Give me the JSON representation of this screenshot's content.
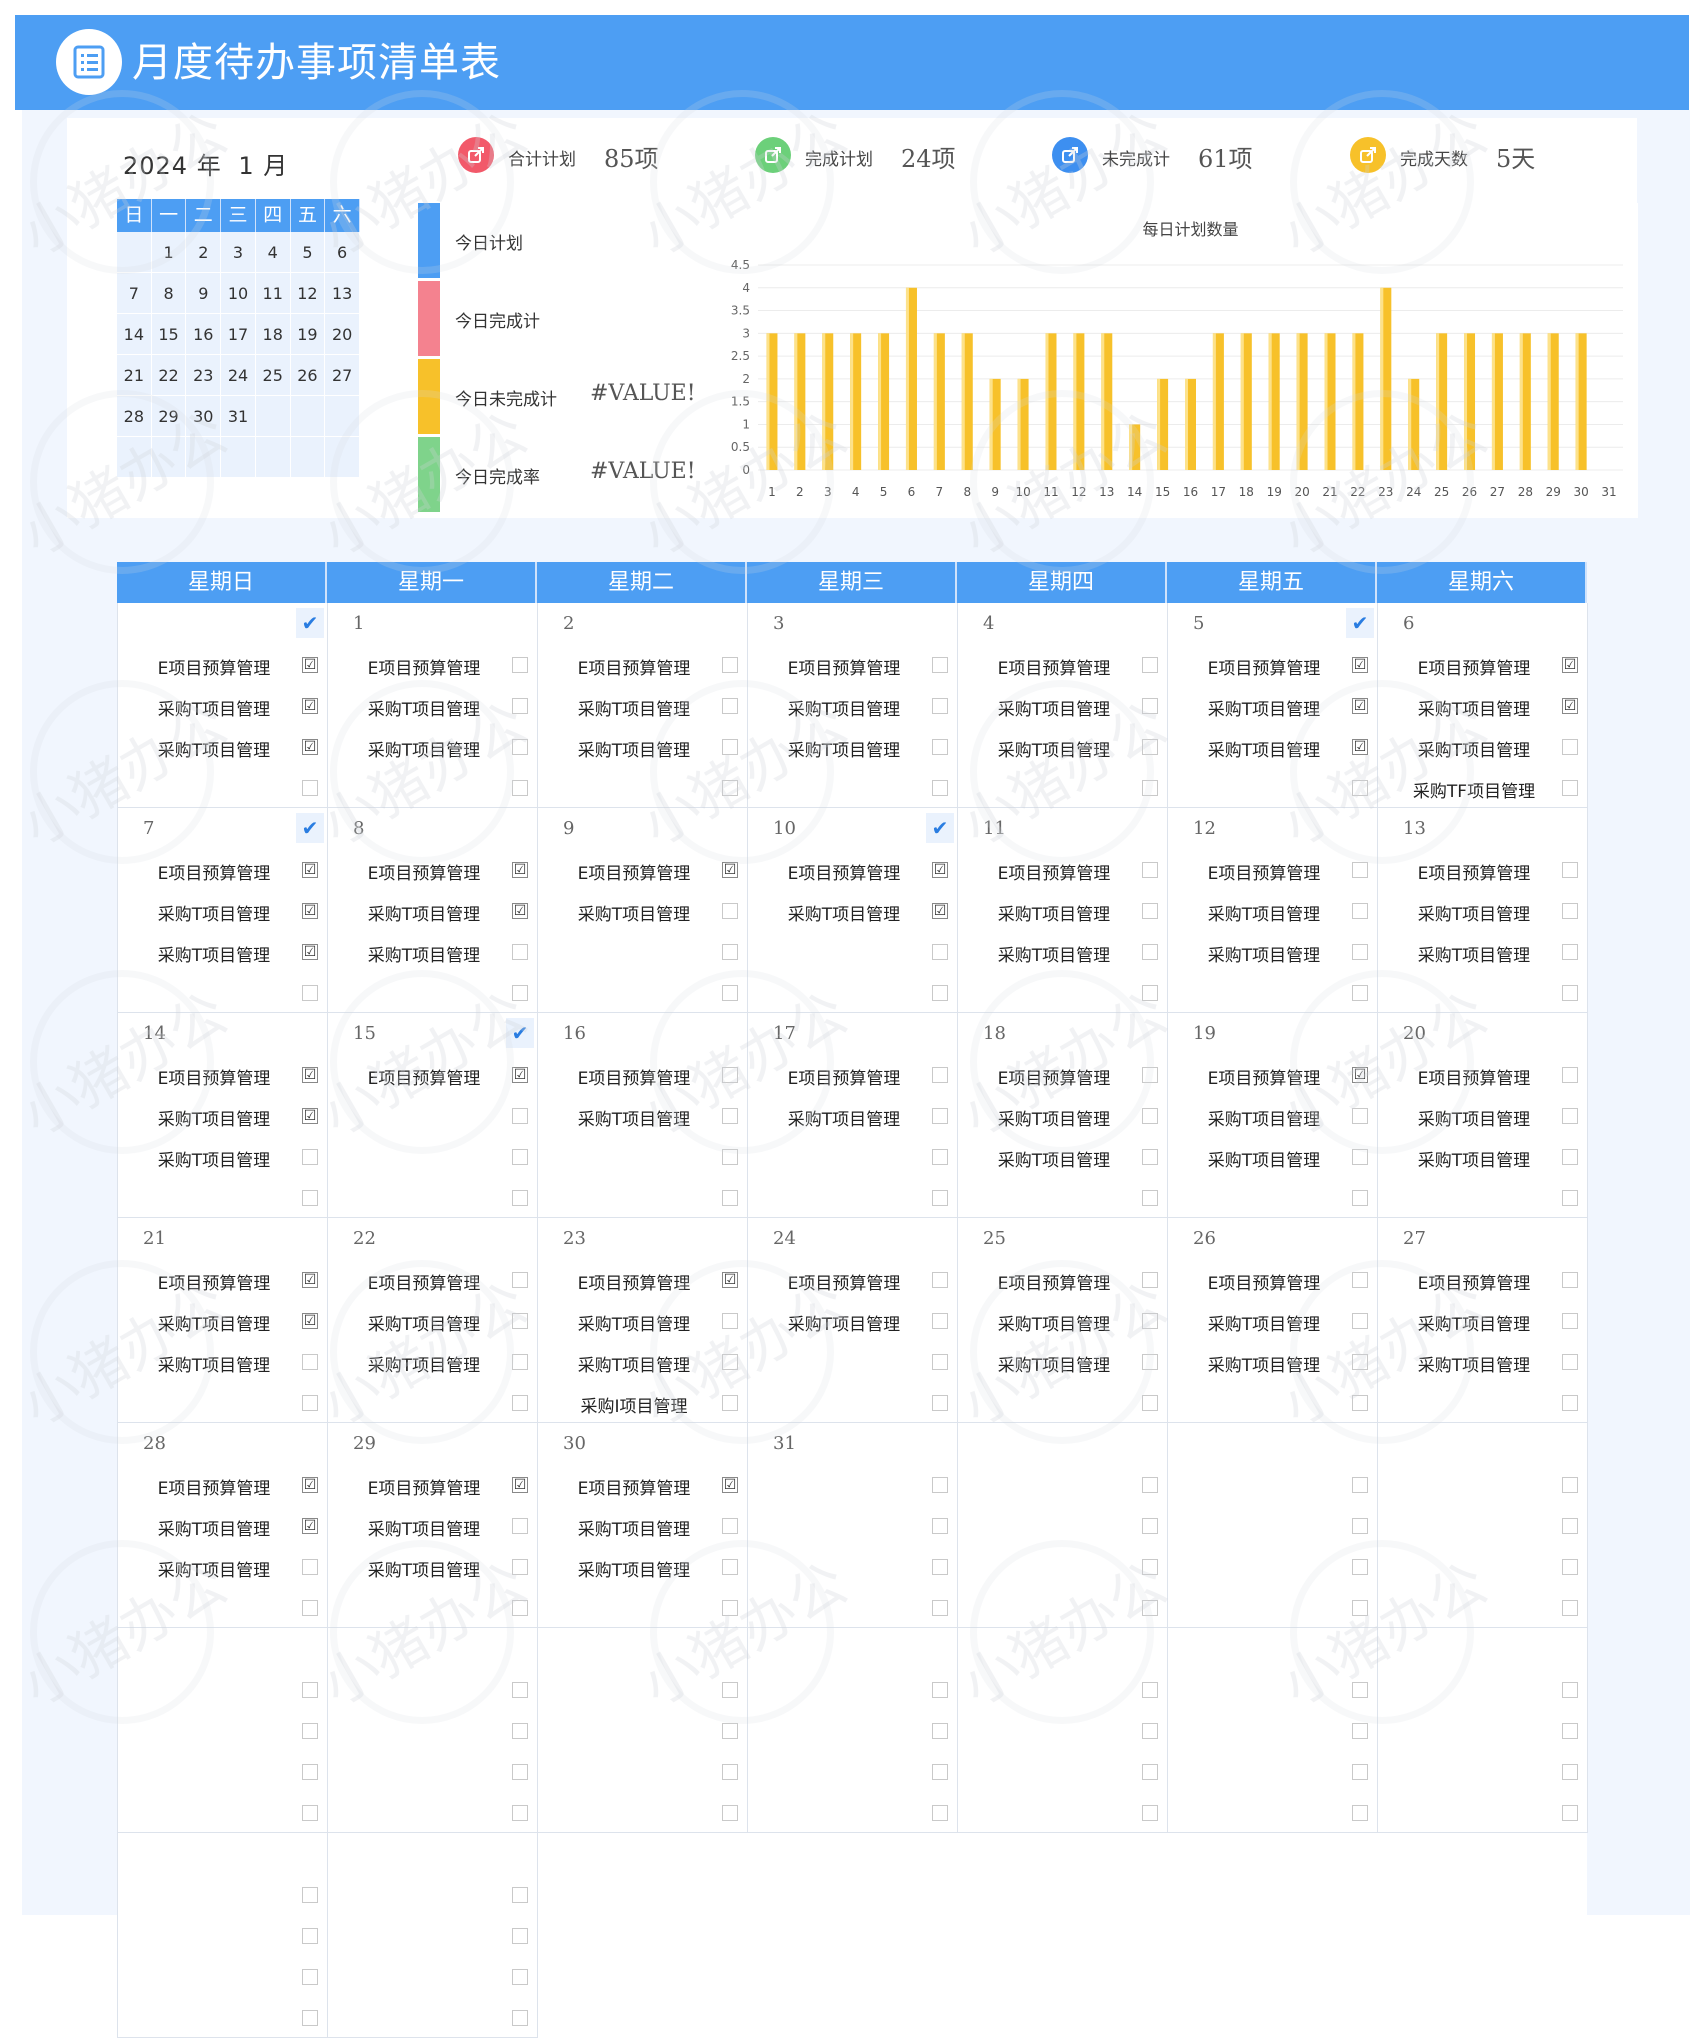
{
  "header": {
    "title": "月度待办事项清单表",
    "icon": "list-icon"
  },
  "mini_cal": {
    "year": "2024",
    "year_unit": "年",
    "month": "1",
    "month_unit": "月",
    "weekdays": [
      "日",
      "一",
      "二",
      "三",
      "四",
      "五",
      "六"
    ],
    "days": [
      "",
      "1",
      "2",
      "3",
      "4",
      "5",
      "6",
      "7",
      "8",
      "9",
      "10",
      "11",
      "12",
      "13",
      "14",
      "15",
      "16",
      "17",
      "18",
      "19",
      "20",
      "21",
      "22",
      "23",
      "24",
      "25",
      "26",
      "27",
      "28",
      "29",
      "30",
      "31",
      "",
      "",
      "",
      "",
      "",
      "",
      "",
      "",
      "",
      ""
    ]
  },
  "stats": [
    {
      "label": "合计计划",
      "value": "85项",
      "color": "#f2596a",
      "icon": "share-icon"
    },
    {
      "label": "完成计划",
      "value": "24项",
      "color": "#6cd07a",
      "icon": "share-icon"
    },
    {
      "label": "未完成计",
      "value": "61项",
      "color": "#3d8ff0",
      "icon": "share-icon"
    },
    {
      "label": "完成天数",
      "value": "5天",
      "color": "#f7c12a",
      "icon": "share-icon"
    }
  ],
  "today": [
    {
      "label": "今日计划",
      "value": "",
      "color": "#4d9ef3"
    },
    {
      "label": "今日完成计",
      "value": "",
      "color": "#f4828f"
    },
    {
      "label": "今日未完成计",
      "value": "#VALUE!",
      "color": "#f7c12a"
    },
    {
      "label": "今日完成率",
      "value": "#VALUE!",
      "color": "#7fd38b"
    }
  ],
  "chart_data": {
    "type": "bar",
    "title": "每日计划数量",
    "categories": [
      "1",
      "2",
      "3",
      "4",
      "5",
      "6",
      "7",
      "8",
      "9",
      "10",
      "11",
      "12",
      "13",
      "14",
      "15",
      "16",
      "17",
      "18",
      "19",
      "20",
      "21",
      "22",
      "23",
      "24",
      "25",
      "26",
      "27",
      "28",
      "29",
      "30",
      "31"
    ],
    "values": [
      3,
      3,
      3,
      3,
      3,
      4,
      3,
      3,
      2,
      2,
      3,
      3,
      3,
      1,
      2,
      2,
      3,
      3,
      3,
      3,
      3,
      3,
      4,
      2,
      3,
      3,
      3,
      3,
      3,
      3,
      0
    ],
    "ylim": [
      0,
      4.5
    ],
    "yticks": [
      "0",
      "0.5",
      "1",
      "1.5",
      "2",
      "2.5",
      "3",
      "3.5",
      "4",
      "4.5"
    ],
    "xlabel": "",
    "ylabel": "",
    "grid": true,
    "color": "#f7c12a"
  },
  "calendar": {
    "weekdays": [
      "星期日",
      "星期一",
      "星期二",
      "星期三",
      "星期四",
      "星期五",
      "星期六"
    ],
    "done_mark": "✔",
    "check_mark": "☑",
    "cells": [
      {
        "day": "",
        "done": true,
        "tasks": [
          {
            "t": "E项目预算管理",
            "c": true
          },
          {
            "t": "采购T项目管理",
            "c": true
          },
          {
            "t": "采购T项目管理",
            "c": true
          },
          {
            "t": "",
            "c": false
          }
        ]
      },
      {
        "day": "1",
        "done": false,
        "tasks": [
          {
            "t": "E项目预算管理",
            "c": false
          },
          {
            "t": "采购T项目管理",
            "c": false
          },
          {
            "t": "采购T项目管理",
            "c": false
          },
          {
            "t": "",
            "c": false
          }
        ]
      },
      {
        "day": "2",
        "done": false,
        "tasks": [
          {
            "t": "E项目预算管理",
            "c": false
          },
          {
            "t": "采购T项目管理",
            "c": false
          },
          {
            "t": "采购T项目管理",
            "c": false
          },
          {
            "t": "",
            "c": false
          }
        ]
      },
      {
        "day": "3",
        "done": false,
        "tasks": [
          {
            "t": "E项目预算管理",
            "c": false
          },
          {
            "t": "采购T项目管理",
            "c": false
          },
          {
            "t": "采购T项目管理",
            "c": false
          },
          {
            "t": "",
            "c": false
          }
        ]
      },
      {
        "day": "4",
        "done": false,
        "tasks": [
          {
            "t": "E项目预算管理",
            "c": false
          },
          {
            "t": "采购T项目管理",
            "c": false
          },
          {
            "t": "采购T项目管理",
            "c": false
          },
          {
            "t": "",
            "c": false
          }
        ]
      },
      {
        "day": "5",
        "done": true,
        "tasks": [
          {
            "t": "E项目预算管理",
            "c": true
          },
          {
            "t": "采购T项目管理",
            "c": true
          },
          {
            "t": "采购T项目管理",
            "c": true
          },
          {
            "t": "",
            "c": false
          }
        ]
      },
      {
        "day": "6",
        "done": false,
        "tasks": [
          {
            "t": "E项目预算管理",
            "c": true
          },
          {
            "t": "采购T项目管理",
            "c": true
          },
          {
            "t": "采购T项目管理",
            "c": false
          },
          {
            "t": "采购TF项目管理",
            "c": false
          }
        ]
      },
      {
        "day": "7",
        "done": true,
        "tasks": [
          {
            "t": "E项目预算管理",
            "c": true
          },
          {
            "t": "采购T项目管理",
            "c": true
          },
          {
            "t": "采购T项目管理",
            "c": true
          },
          {
            "t": "",
            "c": false
          }
        ]
      },
      {
        "day": "8",
        "done": false,
        "tasks": [
          {
            "t": "E项目预算管理",
            "c": true
          },
          {
            "t": "采购T项目管理",
            "c": true
          },
          {
            "t": "采购T项目管理",
            "c": false
          },
          {
            "t": "",
            "c": false
          }
        ]
      },
      {
        "day": "9",
        "done": false,
        "tasks": [
          {
            "t": "E项目预算管理",
            "c": true
          },
          {
            "t": "采购T项目管理",
            "c": false
          },
          {
            "t": "",
            "c": false
          },
          {
            "t": "",
            "c": false
          }
        ]
      },
      {
        "day": "10",
        "done": true,
        "tasks": [
          {
            "t": "E项目预算管理",
            "c": true
          },
          {
            "t": "采购T项目管理",
            "c": true
          },
          {
            "t": "",
            "c": false
          },
          {
            "t": "",
            "c": false
          }
        ]
      },
      {
        "day": "11",
        "done": false,
        "tasks": [
          {
            "t": "E项目预算管理",
            "c": false
          },
          {
            "t": "采购T项目管理",
            "c": false
          },
          {
            "t": "采购T项目管理",
            "c": false
          },
          {
            "t": "",
            "c": false
          }
        ]
      },
      {
        "day": "12",
        "done": false,
        "tasks": [
          {
            "t": "E项目预算管理",
            "c": false
          },
          {
            "t": "采购T项目管理",
            "c": false
          },
          {
            "t": "采购T项目管理",
            "c": false
          },
          {
            "t": "",
            "c": false
          }
        ]
      },
      {
        "day": "13",
        "done": false,
        "tasks": [
          {
            "t": "E项目预算管理",
            "c": false
          },
          {
            "t": "采购T项目管理",
            "c": false
          },
          {
            "t": "采购T项目管理",
            "c": false
          },
          {
            "t": "",
            "c": false
          }
        ]
      },
      {
        "day": "14",
        "done": false,
        "tasks": [
          {
            "t": "E项目预算管理",
            "c": true
          },
          {
            "t": "采购T项目管理",
            "c": true
          },
          {
            "t": "采购T项目管理",
            "c": false
          },
          {
            "t": "",
            "c": false
          }
        ]
      },
      {
        "day": "15",
        "done": true,
        "tasks": [
          {
            "t": "E项目预算管理",
            "c": true
          },
          {
            "t": "",
            "c": false
          },
          {
            "t": "",
            "c": false
          },
          {
            "t": "",
            "c": false
          }
        ]
      },
      {
        "day": "16",
        "done": false,
        "tasks": [
          {
            "t": "E项目预算管理",
            "c": false
          },
          {
            "t": "采购T项目管理",
            "c": false
          },
          {
            "t": "",
            "c": false
          },
          {
            "t": "",
            "c": false
          }
        ]
      },
      {
        "day": "17",
        "done": false,
        "tasks": [
          {
            "t": "E项目预算管理",
            "c": false
          },
          {
            "t": "采购T项目管理",
            "c": false
          },
          {
            "t": "",
            "c": false
          },
          {
            "t": "",
            "c": false
          }
        ]
      },
      {
        "day": "18",
        "done": false,
        "tasks": [
          {
            "t": "E项目预算管理",
            "c": false
          },
          {
            "t": "采购T项目管理",
            "c": false
          },
          {
            "t": "采购T项目管理",
            "c": false
          },
          {
            "t": "",
            "c": false
          }
        ]
      },
      {
        "day": "19",
        "done": false,
        "tasks": [
          {
            "t": "E项目预算管理",
            "c": true
          },
          {
            "t": "采购T项目管理",
            "c": false
          },
          {
            "t": "采购T项目管理",
            "c": false
          },
          {
            "t": "",
            "c": false
          }
        ]
      },
      {
        "day": "20",
        "done": false,
        "tasks": [
          {
            "t": "E项目预算管理",
            "c": false
          },
          {
            "t": "采购T项目管理",
            "c": false
          },
          {
            "t": "采购T项目管理",
            "c": false
          },
          {
            "t": "",
            "c": false
          }
        ]
      },
      {
        "day": "21",
        "done": false,
        "tasks": [
          {
            "t": "E项目预算管理",
            "c": true
          },
          {
            "t": "采购T项目管理",
            "c": true
          },
          {
            "t": "采购T项目管理",
            "c": false
          },
          {
            "t": "",
            "c": false
          }
        ]
      },
      {
        "day": "22",
        "done": false,
        "tasks": [
          {
            "t": "E项目预算管理",
            "c": false
          },
          {
            "t": "采购T项目管理",
            "c": false
          },
          {
            "t": "采购T项目管理",
            "c": false
          },
          {
            "t": "",
            "c": false
          }
        ]
      },
      {
        "day": "23",
        "done": false,
        "tasks": [
          {
            "t": "E项目预算管理",
            "c": true
          },
          {
            "t": "采购T项目管理",
            "c": false
          },
          {
            "t": "采购T项目管理",
            "c": false
          },
          {
            "t": "采购I项目管理",
            "c": false
          }
        ]
      },
      {
        "day": "24",
        "done": false,
        "tasks": [
          {
            "t": "E项目预算管理",
            "c": false
          },
          {
            "t": "采购T项目管理",
            "c": false
          },
          {
            "t": "",
            "c": false
          },
          {
            "t": "",
            "c": false
          }
        ]
      },
      {
        "day": "25",
        "done": false,
        "tasks": [
          {
            "t": "E项目预算管理",
            "c": false
          },
          {
            "t": "采购T项目管理",
            "c": false
          },
          {
            "t": "采购T项目管理",
            "c": false
          },
          {
            "t": "",
            "c": false
          }
        ]
      },
      {
        "day": "26",
        "done": false,
        "tasks": [
          {
            "t": "E项目预算管理",
            "c": false
          },
          {
            "t": "采购T项目管理",
            "c": false
          },
          {
            "t": "采购T项目管理",
            "c": false
          },
          {
            "t": "",
            "c": false
          }
        ]
      },
      {
        "day": "27",
        "done": false,
        "tasks": [
          {
            "t": "E项目预算管理",
            "c": false
          },
          {
            "t": "采购T项目管理",
            "c": false
          },
          {
            "t": "采购T项目管理",
            "c": false
          },
          {
            "t": "",
            "c": false
          }
        ]
      },
      {
        "day": "28",
        "done": false,
        "tasks": [
          {
            "t": "E项目预算管理",
            "c": true
          },
          {
            "t": "采购T项目管理",
            "c": true
          },
          {
            "t": "采购T项目管理",
            "c": false
          },
          {
            "t": "",
            "c": false
          }
        ]
      },
      {
        "day": "29",
        "done": false,
        "tasks": [
          {
            "t": "E项目预算管理",
            "c": true
          },
          {
            "t": "采购T项目管理",
            "c": false
          },
          {
            "t": "采购T项目管理",
            "c": false
          },
          {
            "t": "",
            "c": false
          }
        ]
      },
      {
        "day": "30",
        "done": false,
        "tasks": [
          {
            "t": "E项目预算管理",
            "c": true
          },
          {
            "t": "采购T项目管理",
            "c": false
          },
          {
            "t": "采购T项目管理",
            "c": false
          },
          {
            "t": "",
            "c": false
          }
        ]
      },
      {
        "day": "31",
        "done": false,
        "tasks": [
          {
            "t": "",
            "c": false
          },
          {
            "t": "",
            "c": false
          },
          {
            "t": "",
            "c": false
          },
          {
            "t": "",
            "c": false
          }
        ]
      },
      {
        "day": "",
        "done": false,
        "tasks": [
          {
            "t": "",
            "c": false
          },
          {
            "t": "",
            "c": false
          },
          {
            "t": "",
            "c": false
          },
          {
            "t": "",
            "c": false
          }
        ]
      },
      {
        "day": "",
        "done": false,
        "tasks": [
          {
            "t": "",
            "c": false
          },
          {
            "t": "",
            "c": false
          },
          {
            "t": "",
            "c": false
          },
          {
            "t": "",
            "c": false
          }
        ]
      },
      {
        "day": "",
        "done": false,
        "tasks": [
          {
            "t": "",
            "c": false
          },
          {
            "t": "",
            "c": false
          },
          {
            "t": "",
            "c": false
          },
          {
            "t": "",
            "c": false
          }
        ]
      },
      {
        "day": "",
        "done": false,
        "tasks": [
          {
            "t": "",
            "c": false
          },
          {
            "t": "",
            "c": false
          },
          {
            "t": "",
            "c": false
          },
          {
            "t": "",
            "c": false
          }
        ]
      },
      {
        "day": "",
        "done": false,
        "tasks": [
          {
            "t": "",
            "c": false
          },
          {
            "t": "",
            "c": false
          },
          {
            "t": "",
            "c": false
          },
          {
            "t": "",
            "c": false
          }
        ]
      },
      {
        "day": "",
        "done": false,
        "tasks": [
          {
            "t": "",
            "c": false
          },
          {
            "t": "",
            "c": false
          },
          {
            "t": "",
            "c": false
          },
          {
            "t": "",
            "c": false
          }
        ]
      },
      {
        "day": "",
        "done": false,
        "tasks": [
          {
            "t": "",
            "c": false
          },
          {
            "t": "",
            "c": false
          },
          {
            "t": "",
            "c": false
          },
          {
            "t": "",
            "c": false
          }
        ]
      },
      {
        "day": "",
        "done": false,
        "tasks": [
          {
            "t": "",
            "c": false
          },
          {
            "t": "",
            "c": false
          },
          {
            "t": "",
            "c": false
          },
          {
            "t": "",
            "c": false
          }
        ]
      },
      {
        "day": "",
        "done": false,
        "tasks": [
          {
            "t": "",
            "c": false
          },
          {
            "t": "",
            "c": false
          },
          {
            "t": "",
            "c": false
          },
          {
            "t": "",
            "c": false
          }
        ]
      },
      {
        "day": "",
        "done": false,
        "tasks": [
          {
            "t": "",
            "c": false
          },
          {
            "t": "",
            "c": false
          },
          {
            "t": "",
            "c": false
          },
          {
            "t": "",
            "c": false
          }
        ]
      },
      {
        "day": "",
        "done": false,
        "tasks": [
          {
            "t": "",
            "c": false
          },
          {
            "t": "",
            "c": false
          },
          {
            "t": "",
            "c": false
          },
          {
            "t": "",
            "c": false
          }
        ]
      },
      {
        "day": "",
        "done": false,
        "tasks": [
          {
            "t": "",
            "c": false
          },
          {
            "t": "",
            "c": false
          },
          {
            "t": "",
            "c": false
          },
          {
            "t": "",
            "c": false
          }
        ]
      }
    ]
  },
  "watermark": {
    "text": "小猪办公"
  }
}
